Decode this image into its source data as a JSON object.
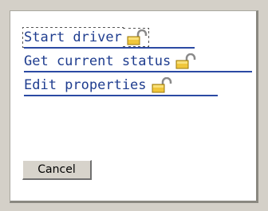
{
  "actions": [
    {
      "label": "Start driver",
      "icon": "lock-open-icon"
    },
    {
      "label": "Get current status",
      "icon": "lock-open-icon"
    },
    {
      "label": "Edit properties",
      "icon": "lock-open-icon"
    }
  ],
  "cancel_label": "Cancel",
  "colors": {
    "link": "#1f3d8f",
    "underline": "#2b4aa3",
    "background": "#ffffff",
    "frame": "#d4d0c8",
    "lock_body": "#f0c63a",
    "lock_shackle": "#8a8a8a"
  }
}
